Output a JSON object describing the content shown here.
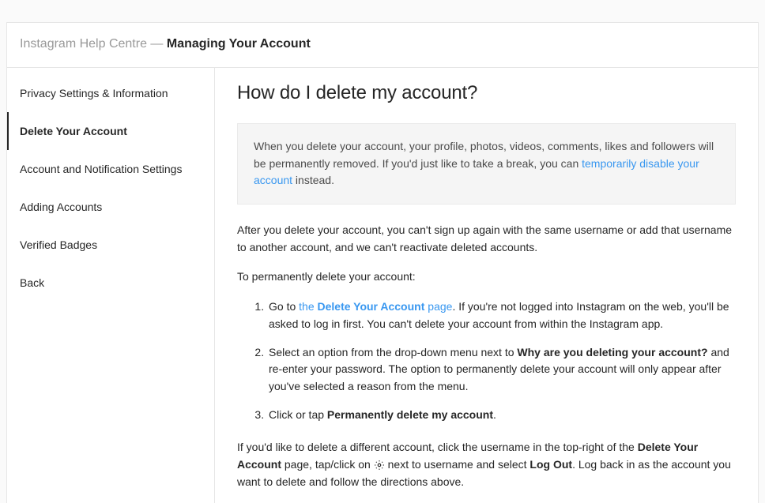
{
  "header": {
    "prefix": "Instagram Help Centre — ",
    "current": "Managing Your Account"
  },
  "sidebar": {
    "items": [
      {
        "label": "Privacy Settings & Information",
        "active": false
      },
      {
        "label": "Delete Your Account",
        "active": true
      },
      {
        "label": "Account and Notification Settings",
        "active": false
      },
      {
        "label": "Adding Accounts",
        "active": false
      },
      {
        "label": "Verified Badges",
        "active": false
      },
      {
        "label": "Back",
        "active": false
      }
    ]
  },
  "content": {
    "title": "How do I delete my account?",
    "callout": {
      "pre": "When you delete your account, your profile, photos, videos, comments, likes and followers will be permanently removed. If you'd just like to take a break, you can ",
      "link": "temporarily disable your account",
      "post": " instead."
    },
    "paragraph1": "After you delete your account, you can't sign up again with the same username or add that username to another account, and we can't reactivate deleted accounts.",
    "paragraph2": "To permanently delete your account:",
    "steps": [
      {
        "pre": "Go to ",
        "link_pre": "the ",
        "link_bold": "Delete Your Account",
        "link_post": " page",
        "post": ". If you're not logged into Instagram on the web, you'll be asked to log in first. You can't delete your account from within the Instagram app."
      },
      {
        "pre": "Select an option from the drop-down menu next to ",
        "bold": "Why are you deleting your account?",
        "post": " and re-enter your password. The option to permanently delete your account will only appear after you've selected a reason from the menu."
      },
      {
        "pre": "Click or tap ",
        "bold": "Permanently delete my account",
        "post": "."
      }
    ],
    "footer": {
      "pre": "If you'd like to delete a different account, click the username in the top-right of the ",
      "bold1": "Delete Your Account",
      "mid1": " page, tap/click on ",
      "mid2": " next to username and select ",
      "bold2": "Log Out",
      "post": ". Log back in as the account you want to delete and follow the directions above."
    }
  }
}
